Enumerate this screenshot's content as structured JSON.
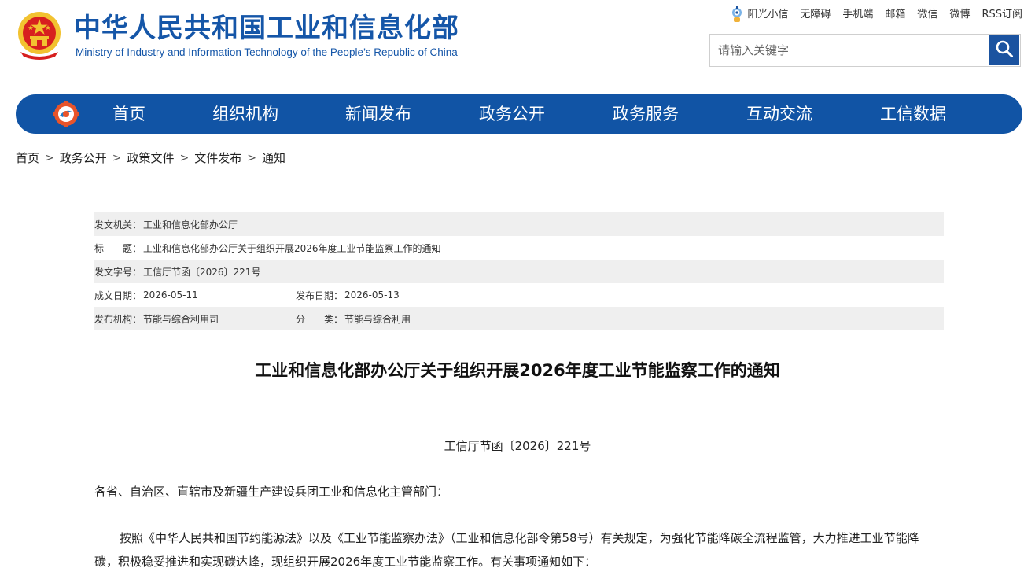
{
  "header": {
    "site_title": "中华人民共和国工业和信息化部",
    "site_subtitle": "Ministry of Industry and Information Technology of the People’s Republic of China",
    "emblem_icon": "national-emblem-icon",
    "top_links": [
      "阳光小信",
      "无障碍",
      "手机端",
      "邮箱",
      "微信",
      "微博",
      "RSS订阅"
    ],
    "search": {
      "placeholder": "请输入关键字",
      "button_icon": "search-icon"
    }
  },
  "nav": {
    "logo_icon": "miit-logo-icon",
    "items": [
      "首页",
      "组织机构",
      "新闻发布",
      "政务公开",
      "政务服务",
      "互动交流",
      "工信数据"
    ]
  },
  "breadcrumb": {
    "items": [
      "首页",
      "政务公开",
      "政策文件",
      "文件发布",
      "通知"
    ],
    "separator": ">"
  },
  "meta": {
    "issuer_label": "发文机关：",
    "issuer": "工业和信息化部办公厅",
    "title_label": "标　　题：",
    "title": "工业和信息化部办公厅关于组织开展2026年度工业节能监察工作的通知",
    "docno_label": "发文字号：",
    "docno": "工信厅节函〔2026〕221号",
    "created_label": "成文日期：",
    "created": "2026-05-11",
    "published_label": "发布日期：",
    "published": "2026-05-13",
    "org_label": "发布机构：",
    "org": "节能与综合利用司",
    "category_label": "分　　类：",
    "category": "节能与综合利用"
  },
  "article": {
    "title": "工业和信息化部办公厅关于组织开展2026年度工业节能监察工作的通知",
    "doc_no": "工信厅节函〔2026〕221号",
    "salutation": "各省、自治区、直辖市及新疆生产建设兵团工业和信息化主管部门：",
    "paragraph": "按照《中华人民共和国节约能源法》以及《工业节能监察办法》（工业和信息化部令第58号）有关规定，为强化节能降碳全流程监管，大力推进工业节能降碳，积极稳妥推进和实现碳达峰，现组织开展2026年度工业节能监察工作。有关事项通知如下："
  },
  "colors": {
    "brand_blue": "#1154a5",
    "title_blue": "#1556a8",
    "emblem_red": "#d71f1f",
    "emblem_gold": "#f2c230",
    "meta_shade": "#efefef"
  }
}
